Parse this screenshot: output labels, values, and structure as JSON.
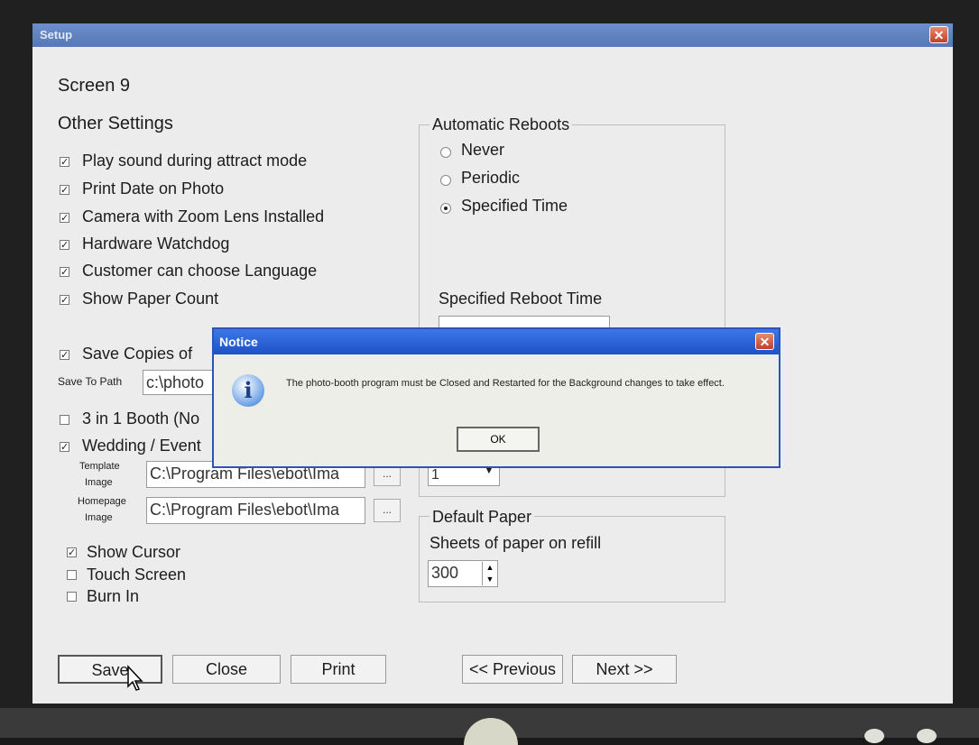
{
  "window": {
    "title": "Setup",
    "close_glyph": "✕"
  },
  "screen": {
    "heading": "Screen 9",
    "section_title": "Other Settings",
    "options": [
      {
        "label": "Play sound during attract mode",
        "checked": true
      },
      {
        "label": "Print Date on Photo",
        "checked": true
      },
      {
        "label": "Camera with Zoom Lens Installed",
        "checked": true
      },
      {
        "label": "Hardware Watchdog",
        "checked": true
      },
      {
        "label": "Customer can choose Language",
        "checked": true
      },
      {
        "label": "Show Paper Count",
        "checked": true
      }
    ],
    "save_copies": {
      "label": "Save Copies of",
      "checked": true
    },
    "save_to_path": {
      "label": "Save To Path",
      "value": "c:\\photo"
    },
    "three_in_one": {
      "label": "3 in 1 Booth (No",
      "checked": false
    },
    "wedding": {
      "label": "Wedding / Event",
      "checked": true
    },
    "template_image": {
      "label_1": "Template",
      "label_2": "Image",
      "value": "C:\\Program Files\\ebot\\Ima",
      "browse": "..."
    },
    "homepage_image": {
      "label_1": "Homepage",
      "label_2": "Image",
      "value": "C:\\Program Files\\ebot\\Ima",
      "browse": "..."
    },
    "show_cursor": {
      "label": "Show Cursor",
      "checked": true
    },
    "touch_screen": {
      "label": "Touch Screen",
      "checked": false
    },
    "burn_in": {
      "label": "Burn In",
      "checked": false
    },
    "reboots": {
      "legend": "Automatic Reboots",
      "never": "Never",
      "periodic": "Periodic",
      "specified": "Specified Time",
      "selected": "specified",
      "reboot_time_label": "Specified Reboot Time",
      "combo_value": "1"
    },
    "default_paper": {
      "legend": "Default Paper",
      "label": "Sheets of paper on refill",
      "value": "300"
    },
    "buttons": {
      "save": "Save",
      "close": "Close",
      "print": "Print",
      "previous": "<< Previous",
      "next": "Next >>"
    }
  },
  "dialog": {
    "title": "Notice",
    "close_glyph": "✕",
    "icon": "info-icon",
    "message": "The photo-booth program must be Closed and Restarted for the Background changes to take effect.",
    "ok": "OK"
  },
  "colors": {
    "titlebar": "#5f82c0",
    "dialog_title": "#2a60d8",
    "close_red": "#d04a30",
    "panel": "#ececec"
  }
}
